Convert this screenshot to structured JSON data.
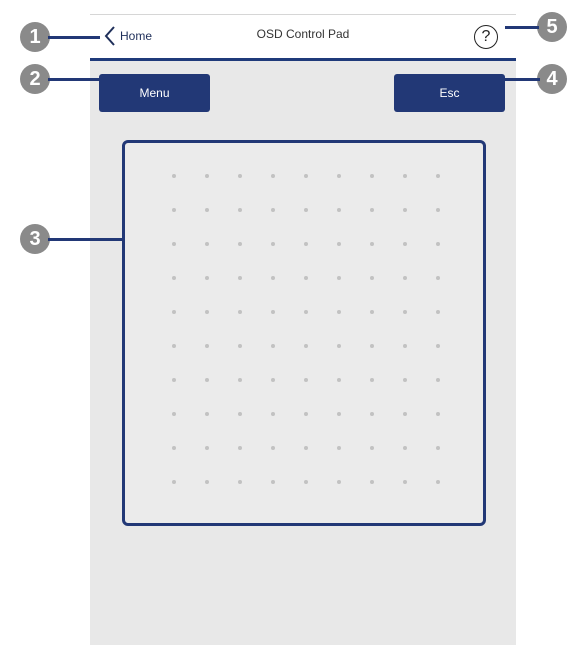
{
  "nav": {
    "back_label": "Home",
    "title": "OSD Control Pad",
    "help_symbol": "?"
  },
  "buttons": {
    "menu_label": "Menu",
    "esc_label": "Esc"
  },
  "callouts": [
    "1",
    "2",
    "3",
    "4",
    "5"
  ],
  "colors": {
    "accent": "#223876",
    "background": "#e8e8e8",
    "callout": "#8a8a8a"
  },
  "icons": {
    "back": "chevron-left-icon",
    "help": "question-circle-icon"
  }
}
